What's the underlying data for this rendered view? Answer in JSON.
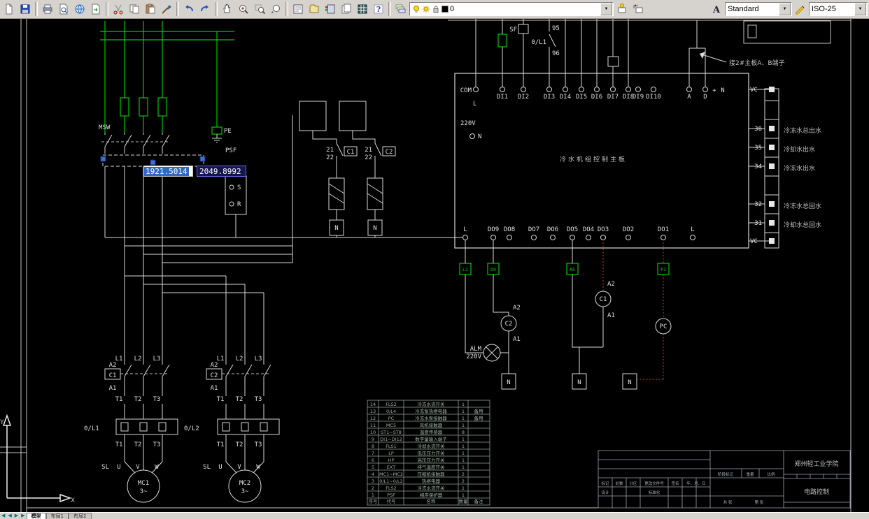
{
  "toolbar": {
    "layer_value": "0",
    "text_style_value": "Standard",
    "dim_style_value": "ISO-25"
  },
  "dyninput": {
    "x": "1921.5014",
    "y": "2049.8992"
  },
  "statusbar": {
    "tabs": [
      "模型",
      "布局1",
      "布局2"
    ]
  },
  "sch": {
    "power": {
      "msw": "MSW",
      "pe": "PE",
      "psf": "PSF",
      "s": "S",
      "r": "R"
    },
    "ht": {
      "a21": "21",
      "a22": "22",
      "c1": "C1",
      "b21": "21",
      "b22": "22",
      "c2": "C2",
      "n1": "N",
      "n2": "N"
    },
    "board": {
      "title": "冷水机组控制主板",
      "com": "COM",
      "l_top": "L",
      "v220": "220V",
      "n_left": "N",
      "di": [
        "DI1",
        "DI2",
        "DI3",
        "DI4",
        "DI5",
        "DI6",
        "DI7",
        "DI8",
        "DI9",
        "DI10"
      ],
      "ad": [
        "A",
        "D",
        "+",
        "N"
      ],
      "dob": [
        "L",
        "DO9",
        "DO8",
        "DO7",
        "DO6",
        "DO5",
        "DO4",
        "DO3",
        "DO2",
        "DO1",
        "L"
      ],
      "vc_top": "VC",
      "vc_bot": "VC"
    },
    "term": {
      "nums": [
        "36",
        "35",
        "34",
        "32",
        "31"
      ],
      "labels": [
        "冷冻水总出水",
        "冷却水出水",
        "冷冻水出水",
        "冷冻水总回水",
        "冷却水总回水"
      ]
    },
    "top": {
      "sf": "SF",
      "p95": "95",
      "ol": "0/L1",
      "p96": "96",
      "note": "接2#主板A、B端子"
    },
    "mid": {
      "alm1": "ALM",
      "alm2": "220V",
      "c2a2": "A2",
      "c2": "C2",
      "c2a1": "A1",
      "c1a2": "A2",
      "c1": "C1",
      "c1a1": "A1",
      "pc": "PC",
      "n1": "N",
      "n2": "N",
      "n3": "N",
      "tags": [
        "L1",
        "D9",
        "A5",
        "P1"
      ]
    },
    "m1": {
      "a2": "A2",
      "coil": "C1",
      "a1": "A1",
      "l": [
        "L1",
        "L2",
        "L3"
      ],
      "t": [
        "T1",
        "T2",
        "T3"
      ],
      "ol": "0/L1",
      "tb": [
        "T1",
        "T2",
        "T3"
      ],
      "sl": "SL",
      "u": "U",
      "v": "V",
      "w": "W",
      "name": "MC1",
      "ph": "3~"
    },
    "m2": {
      "a2": "A2",
      "coil": "C2",
      "a1": "A1",
      "l": [
        "L1",
        "L2",
        "L3"
      ],
      "t": [
        "T1",
        "T2",
        "T3"
      ],
      "ol": "0/L2",
      "tb": [
        "T1",
        "T2",
        "T3"
      ],
      "sl": "SL",
      "u": "U",
      "v": "V",
      "w": "W",
      "name": "MC2",
      "ph": "3~"
    },
    "bom": {
      "headers": [
        "序号",
        "代号",
        "名称",
        "数量",
        "备注"
      ],
      "rows": [
        [
          "14",
          "FLS2",
          "冷冻水流开关",
          "1",
          ""
        ],
        [
          "13",
          "0/L4",
          "冷冻泵热继电器",
          "1",
          "备用"
        ],
        [
          "12",
          "PC",
          "冷冻水泵接触器",
          "1",
          "备用"
        ],
        [
          "11",
          "MC5",
          "风机接触器",
          "1",
          ""
        ],
        [
          "10",
          "ST1~ST8",
          "温度传感器",
          "8",
          ""
        ],
        [
          "9",
          "DI1~DI12",
          "数字量输入端子",
          "1",
          ""
        ],
        [
          "8",
          "FLS1",
          "冷却水流开关",
          "1",
          ""
        ],
        [
          "7",
          "LP",
          "低压压力开关",
          "1",
          ""
        ],
        [
          "6",
          "HP",
          "高压压力开关",
          "1",
          ""
        ],
        [
          "5",
          "EXT",
          "排气温度开关",
          "1",
          ""
        ],
        [
          "4",
          "MC1~MC2",
          "压缩机接触器",
          "2",
          ""
        ],
        [
          "3",
          "0/L1~0/L2",
          "热继电器",
          "2",
          ""
        ],
        [
          "2",
          "FLS2",
          "冷冻水流开关",
          "1",
          ""
        ],
        [
          "1",
          "PSF",
          "相序保护器",
          "1",
          ""
        ]
      ]
    },
    "tblk": {
      "school": "郑州轻工业学院",
      "title": "电路控制",
      "rev": [
        "标记",
        "处数",
        "分区",
        "更改文件号",
        "签名",
        "年、月、日"
      ],
      "design": "设计",
      "standard": "标准化",
      "stage": "阶段标记",
      "weight": "重量",
      "scale": "比例",
      "sheets": "共 张",
      "sheetno": "第 张"
    },
    "ucs": {
      "x": "X",
      "y": "Y"
    }
  }
}
